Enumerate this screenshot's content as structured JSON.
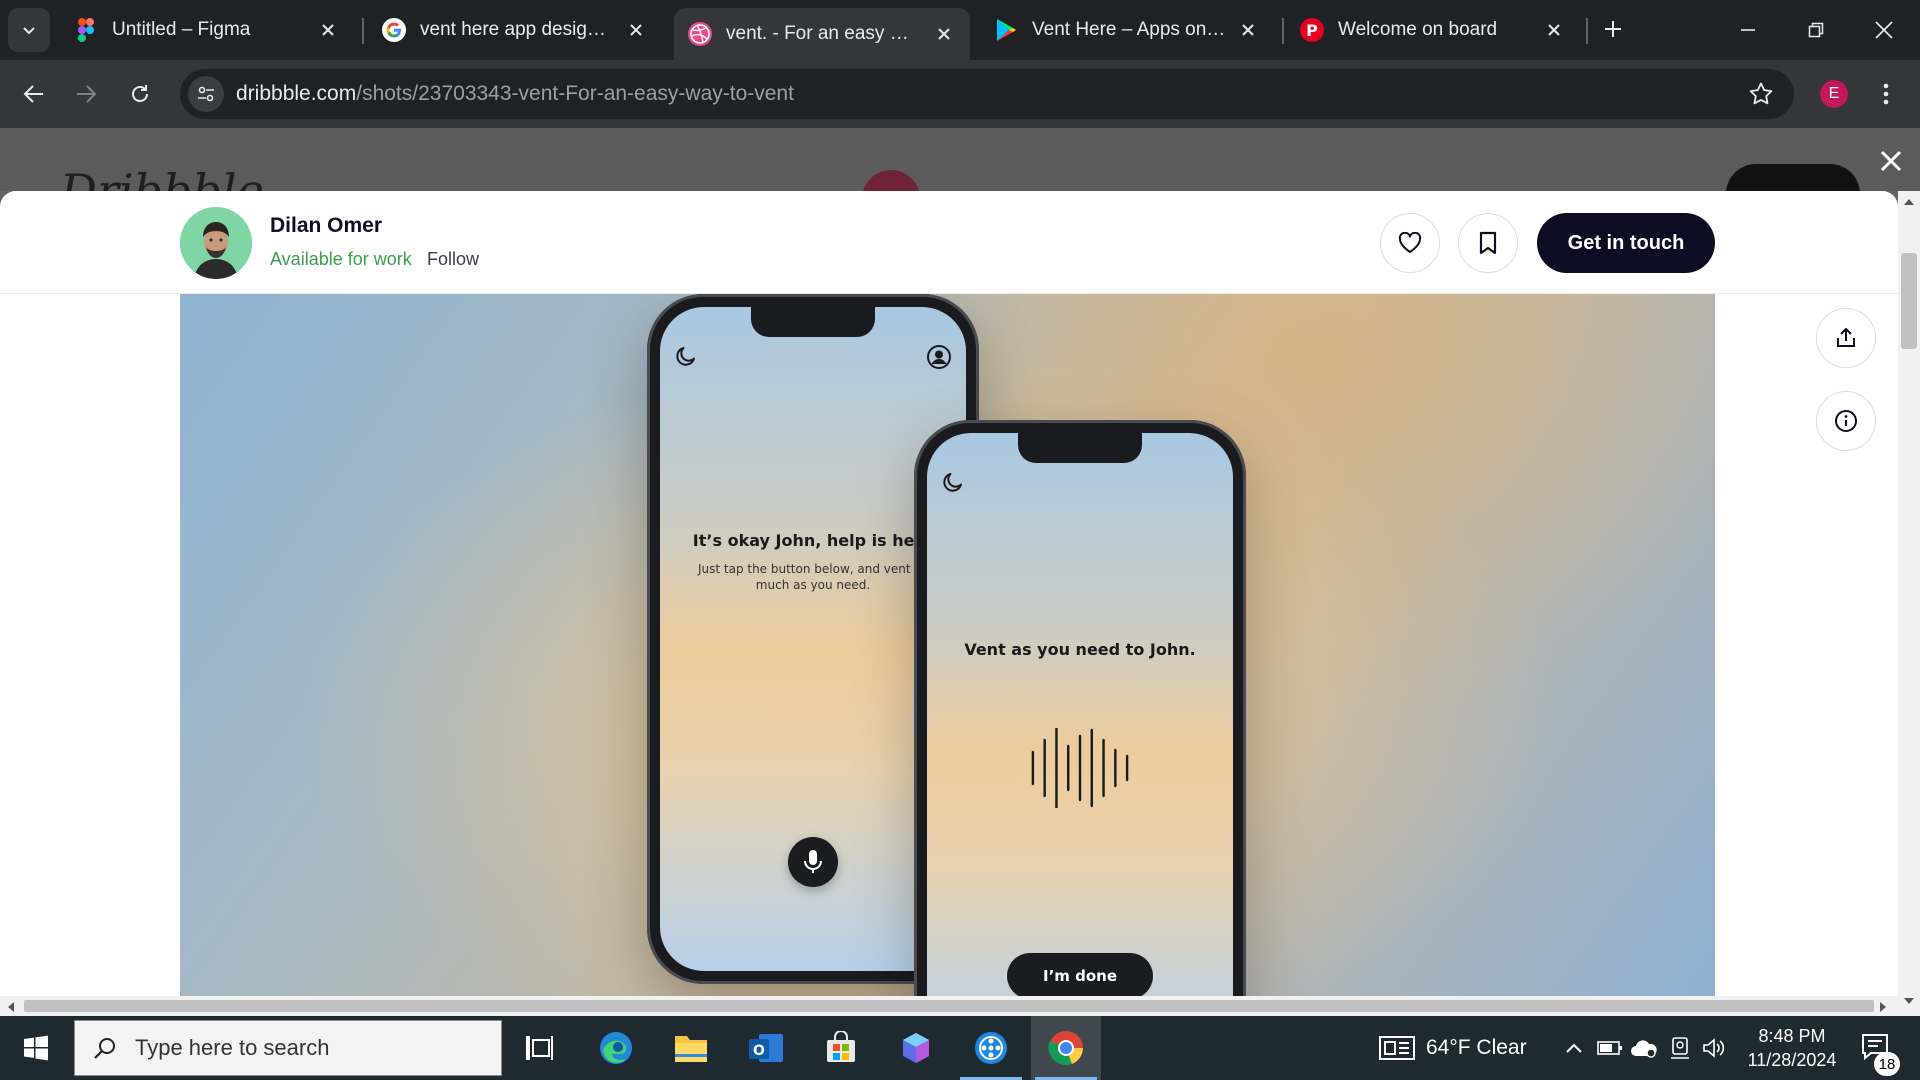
{
  "browser": {
    "tabs": [
      {
        "title": "Untitled – Figma",
        "icon": "figma-icon"
      },
      {
        "title": "vent here app design - Google Search",
        "icon": "google-icon"
      },
      {
        "title": "vent. - For an easy way to vent by Dilan Omer",
        "icon": "dribbble-icon",
        "active": true
      },
      {
        "title": "Vent Here – Apps on Google Play",
        "icon": "google-play-icon"
      },
      {
        "title": "Welcome on board",
        "icon": "pinterest-icon"
      }
    ],
    "url": {
      "host": "dribbble.com",
      "path": "/shots/23703343-vent-For-an-easy-way-to-vent"
    },
    "profile_initial": "E"
  },
  "background_page": {
    "logo": "Dribbble"
  },
  "shot": {
    "author_name": "Dilan Omer",
    "availability": "Available for work",
    "follow_label": "Follow",
    "contact_label": "Get in touch",
    "like_icon": "heart-icon",
    "save_icon": "bookmark-icon",
    "share_icon": "share-icon",
    "info_icon": "info-icon"
  },
  "phone_left": {
    "heading": "It’s okay John, help is here",
    "subtext_line1": "Just tap the button below, and vent as",
    "subtext_line2": "much as you need.",
    "mic_icon": "microphone-icon"
  },
  "phone_right": {
    "heading": "Vent as you need to John.",
    "done_label": "I’m done",
    "waveform_levels": [
      0.4,
      0.7,
      1.0,
      0.55,
      0.8,
      0.95,
      0.7,
      0.45,
      0.3
    ]
  },
  "taskbar": {
    "search_placeholder": "Type here to search",
    "weather": "64°F  Clear",
    "time": "8:48 PM",
    "date": "11/28/2024",
    "notification_count": "18",
    "running_color": "#7cb6f4"
  },
  "colors": {
    "brand_dark": "#0d0c22",
    "available_green": "#3b9e4c",
    "profile_pink": "#c2185b"
  }
}
